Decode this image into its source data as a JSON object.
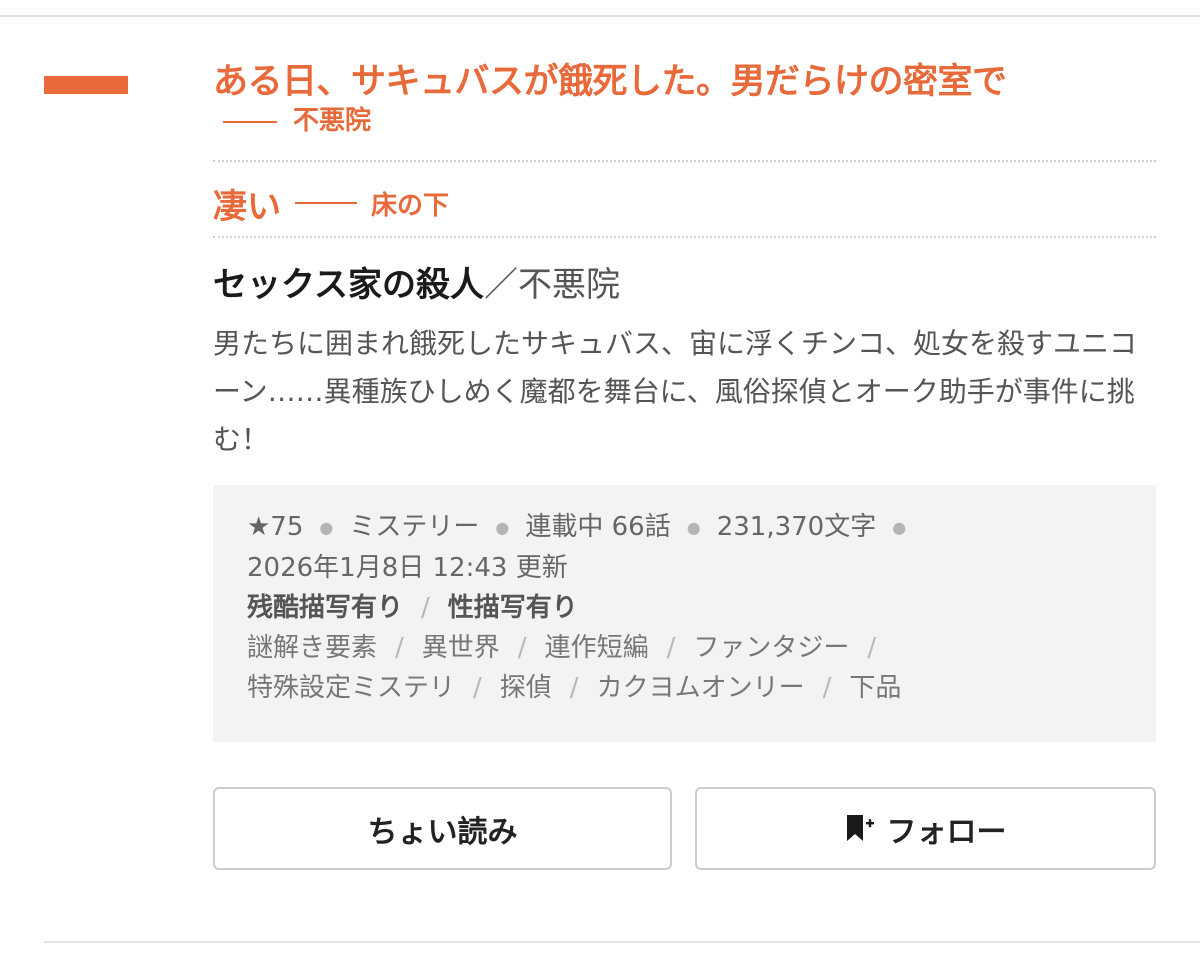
{
  "review": {
    "title": "ある日、サキュバスが餓死した。男だらけの密室で",
    "author": "不悪院"
  },
  "rating_review": {
    "word": "凄い",
    "author": "床の下"
  },
  "work": {
    "title": "セックス家の殺人",
    "separator": "／",
    "author": "不悪院",
    "catchphrase": "男たちに囲まれ餓死したサキュバス、宙に浮くチンコ、処女を殺すユニコーン……異種族ひしめく魔都を舞台に、風俗探偵とオーク助手が事件に挑む！"
  },
  "meta": {
    "stars": "★75",
    "genre": "ミステリー",
    "status": "連載中 66話",
    "chars": "231,370文字",
    "updated": "2026年1月8日 12:43 更新",
    "warnings": [
      "残酷描写有り",
      "性描写有り"
    ],
    "tags": [
      "謎解き要素",
      "異世界",
      "連作短編",
      "ファンタジー",
      "特殊設定ミステリ",
      "探偵",
      "カクヨムオンリー",
      "下品"
    ]
  },
  "buttons": {
    "read_label": "ちょい読み",
    "follow_label": "フォロー"
  },
  "colors": {
    "accent": "#e8693a",
    "meta_bg": "#f4f3f1"
  },
  "icons": {
    "follow": "bookmark-plus-icon"
  }
}
